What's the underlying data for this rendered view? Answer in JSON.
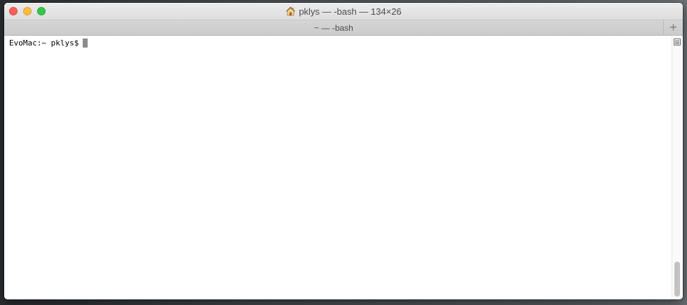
{
  "window": {
    "title": "pklys — -bash — 134×26",
    "title_icon": "home-icon"
  },
  "tabbar": {
    "active_tab_label": "~ — -bash",
    "new_tab_label": "+"
  },
  "terminal": {
    "prompt": "EvoMac:~ pklys$"
  },
  "scrollbar": {
    "position": 1.0
  },
  "colors": {
    "close": "#fc605c",
    "minimize": "#fdbc40",
    "maximize": "#34c84a"
  }
}
